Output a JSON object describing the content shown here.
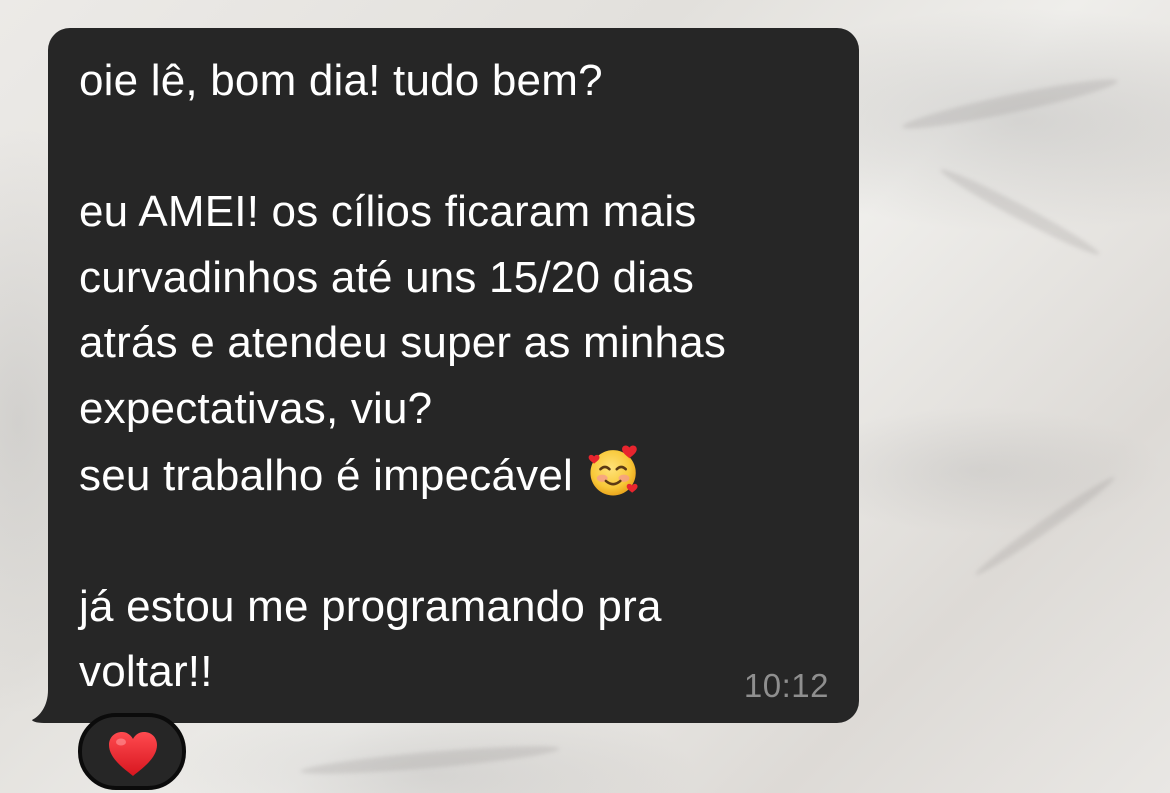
{
  "message": {
    "lines": [
      "oie lê, bom dia! tudo bem?",
      "",
      "eu AMEI! os cílios ficaram mais",
      "curvadinhos até uns 15/20 dias",
      "atrás e atendeu super as minhas",
      "expectativas, viu?",
      "seu trabalho é impecável",
      "",
      "já estou me programando pra",
      "voltar!!"
    ],
    "emoji": "smiling-face-with-hearts-icon",
    "timestamp": "10:12",
    "bubble_color": "#262626",
    "text_color": "#ffffff",
    "timestamp_color": "#8f8f8f"
  },
  "reaction": {
    "emoji": "red-heart-icon",
    "color": "#e8252e"
  }
}
